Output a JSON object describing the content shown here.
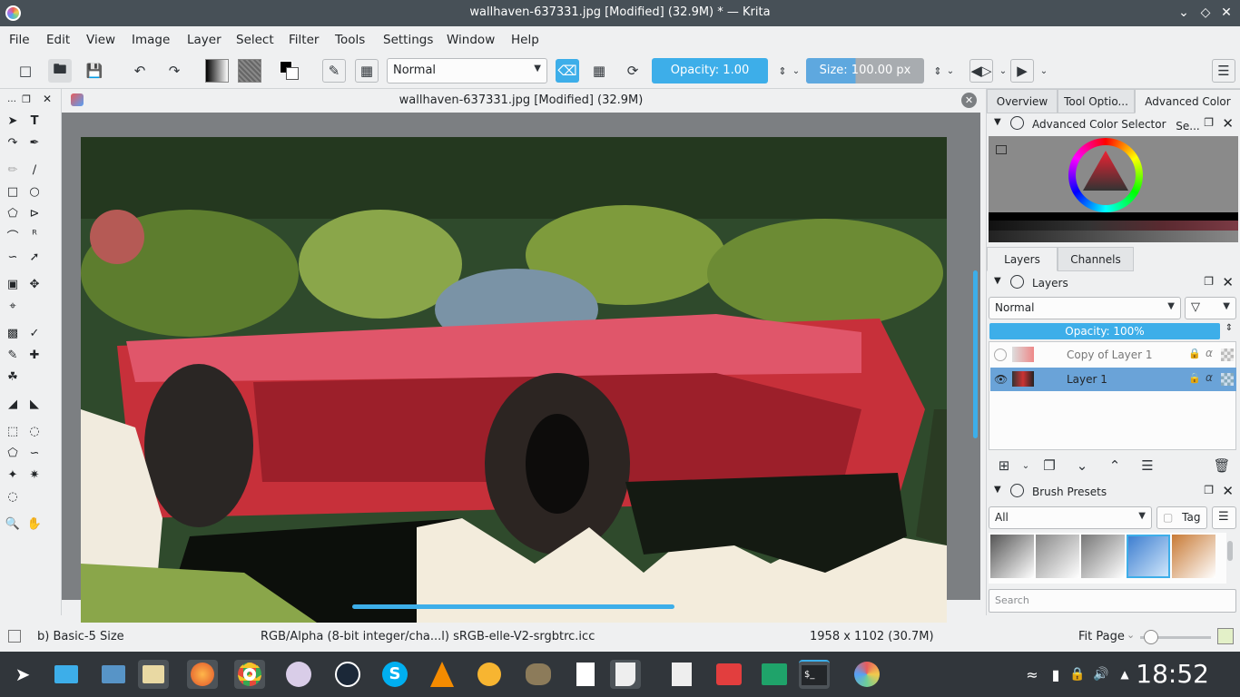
{
  "window": {
    "title": "wallhaven-637331.jpg [Modified] (32.9M) * — Krita"
  },
  "menu": [
    "File",
    "Edit",
    "View",
    "Image",
    "Layer",
    "Select",
    "Filter",
    "Tools",
    "Settings",
    "Window",
    "Help"
  ],
  "toolbar": {
    "blend_mode": "Normal",
    "opacity_label": "Opacity:  1.00",
    "size_label": "Size:  100.00 px"
  },
  "document": {
    "tab_title": "wallhaven-637331.jpg [Modified]  (32.9M)"
  },
  "dock": {
    "top_tabs": [
      "Overview",
      "Tool Optio...",
      "Advanced Color Se..."
    ],
    "color_selector_title": "Advanced Color Selector",
    "layer_tabs": [
      "Layers",
      "Channels"
    ],
    "layers_title": "Layers",
    "layers_blend": "Normal",
    "layers_opacity": "Opacity:  100%",
    "layers": [
      {
        "name": "Copy of Layer 1",
        "visible": false,
        "selected": false
      },
      {
        "name": "Layer 1",
        "visible": true,
        "selected": true
      }
    ],
    "brush_title": "Brush Presets",
    "brush_filter": "All",
    "brush_tag": "Tag",
    "brush_search_placeholder": "Search"
  },
  "status": {
    "brush": "b) Basic-5 Size",
    "color_space": "RGB/Alpha (8-bit integer/cha...l)  sRGB-elle-V2-srgbtrc.icc",
    "dimensions": "1958 x 1102 (30.7M)",
    "zoom": "Fit Page"
  },
  "taskbar": {
    "clock": "18:52"
  },
  "colors": {
    "accent": "#3daee9",
    "titlebar": "#475057",
    "taskbar": "#31363b",
    "selected_layer": "#6aa3d8"
  }
}
